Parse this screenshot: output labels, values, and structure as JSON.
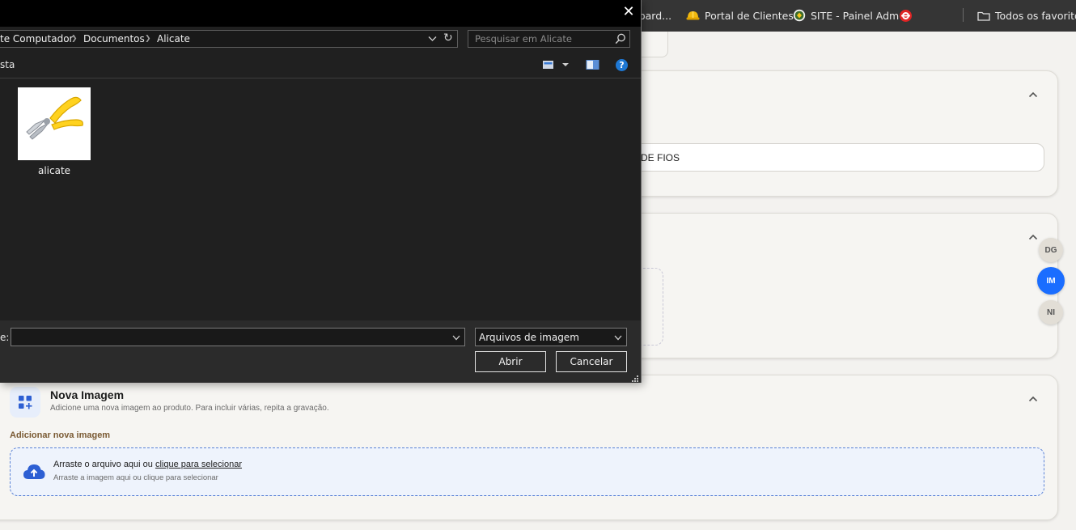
{
  "browser": {
    "bookmarks": [
      {
        "label": "oard...",
        "icon": "partial-bookmark"
      },
      {
        "label": "Portal de Clientes",
        "icon": "helmet-icon"
      },
      {
        "label": "SITE - Painel Adm",
        "icon": "site-logo-icon"
      },
      {
        "label": "",
        "icon": "red-logo-icon"
      }
    ],
    "all_bookmarks_label": "Todos os favoritos"
  },
  "dialog": {
    "breadcrumbs": [
      "te Computador",
      "Documentos",
      "Alicate"
    ],
    "search_placeholder": "Pesquisar em Alicate",
    "toolbar_label": "sta",
    "files": [
      {
        "name": "alicate"
      }
    ],
    "filename_label": "e:",
    "filename_value": "",
    "filetype_value": "Arquivos de imagem",
    "open_label": "Abrir",
    "cancel_label": "Cancelar",
    "help_label": "?"
  },
  "page": {
    "fios_field_text": "DE FIOS",
    "avatars": [
      {
        "initials": "DG",
        "active": false
      },
      {
        "initials": "IM",
        "active": true
      },
      {
        "initials": "NI",
        "active": false
      }
    ],
    "nova_imagem": {
      "title": "Nova Imagem",
      "subtitle": "Adicione uma nova imagem ao produto. Para incluir várias, repita a gravação.",
      "field_label": "Adicionar nova imagem",
      "drop_text": "Arraste o arquivo aqui ou ",
      "drop_link": "clique para selecionar",
      "drop_hint": "Arraste a imagem aqui ou clique para selecionar"
    }
  },
  "colors": {
    "accent": "#1a6dff",
    "dialog_bg": "#202020",
    "label_brown": "#7a5a33"
  }
}
